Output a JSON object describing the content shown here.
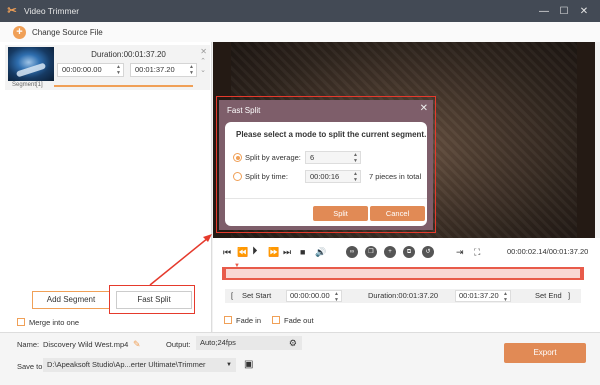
{
  "window": {
    "title": "Video Trimmer"
  },
  "toolbar": {
    "change_source_label": "Change Source File"
  },
  "segment": {
    "duration_label": "Duration:00:01:37.20",
    "start_time": "00:00:00.00",
    "end_time": "00:01:37.20",
    "label": "Segment[1]"
  },
  "left_actions": {
    "add_segment_label": "Add Segment",
    "fast_split_label": "Fast Split",
    "merge_label": "Merge into one"
  },
  "dialog": {
    "title": "Fast Split",
    "heading": "Please select a mode to split the current segment.",
    "option_average_label": "Split by average:",
    "average_value": "6",
    "option_time_label": "Split by time:",
    "time_value": "00:00:16",
    "pieces_label": "7 pieces in total",
    "selected_option": "average",
    "split_label": "Split",
    "cancel_label": "Cancel"
  },
  "playback": {
    "current_time": "00:00:02.14/00:01:37.20"
  },
  "trim": {
    "set_start_label": "Set Start",
    "start_time": "00:00:00.00",
    "duration_label": "Duration:00:01:37.20",
    "end_time": "00:01:37.20",
    "set_end_label": "Set End",
    "fade_in_label": "Fade in",
    "fade_out_label": "Fade out"
  },
  "output": {
    "name_label": "Name:",
    "name_value": "Discovery Wild West.mp4",
    "output_label": "Output:",
    "output_value": "Auto;24fps",
    "save_to_label": "Save to:",
    "save_to_value": "D:\\Apeaksoft Studio\\Ap...erter Ultimate\\Trimmer",
    "export_label": "Export"
  },
  "colors": {
    "accent": "#f0a057",
    "titlebar": "#434a55",
    "annotation": "#e53a2c",
    "dialog_header": "#7e5e6a"
  }
}
